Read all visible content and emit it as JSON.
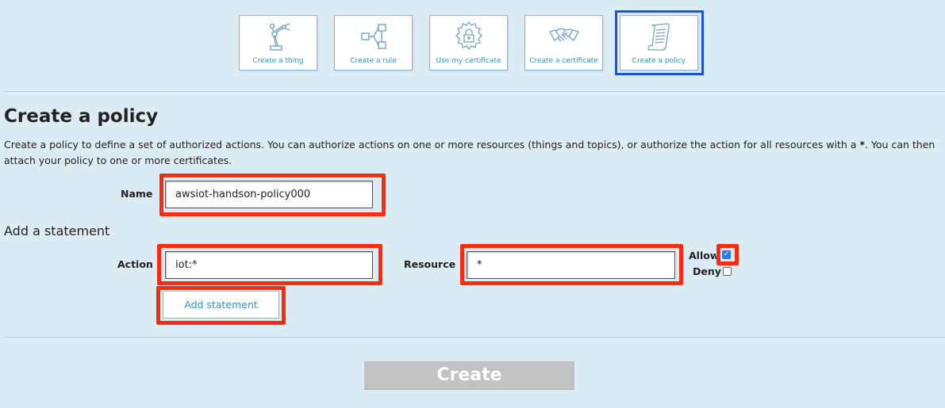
{
  "tiles": [
    {
      "label": "Create a thing",
      "icon": "robot-arm-icon"
    },
    {
      "label": "Create a rule",
      "icon": "flow-icon"
    },
    {
      "label": "Use my certificate",
      "icon": "lock-badge-icon"
    },
    {
      "label": "Create a certificate",
      "icon": "handshake-icon"
    },
    {
      "label": "Create a policy",
      "icon": "document-icon"
    }
  ],
  "active_tile": "Create a policy",
  "page": {
    "title": "Create a policy",
    "description_part1": "Create a policy to define a set of authorized actions. You can authorize actions on one or more resources (things and topics), or authorize the action for all resources with a ",
    "description_bold": "*",
    "description_part2": ". You can then attach your policy to one or more certificates."
  },
  "form": {
    "name_label": "Name",
    "name_value": "awsiot-handson-policy000",
    "statement_heading": "Add a statement",
    "action_label": "Action",
    "action_value": "iot:*",
    "resource_label": "Resource",
    "resource_value": "*",
    "allow_label": "Allow",
    "allow_checked": true,
    "deny_label": "Deny",
    "deny_checked": false,
    "add_statement_label": "Add statement",
    "create_label": "Create"
  },
  "colors": {
    "background": "#dcecf5",
    "accent": "#3d8fc4",
    "highlight": "#ff2a0e",
    "active_border": "#1a55e0",
    "disabled_button": "#c2c2c2"
  }
}
